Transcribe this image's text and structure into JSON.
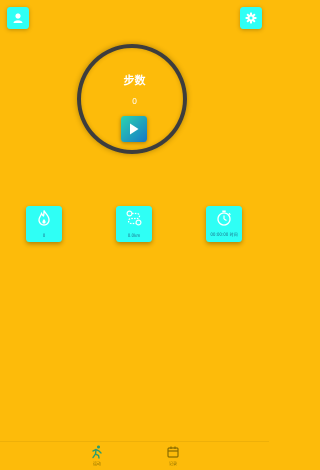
{
  "header": {
    "profile_icon": "person-icon",
    "settings_icon": "gear-icon"
  },
  "steps": {
    "title": "步数",
    "count": "0",
    "play_icon": "play-icon"
  },
  "stats": [
    {
      "icon": "flame-icon",
      "value": "0"
    },
    {
      "icon": "route-icon",
      "value": "0.0km"
    },
    {
      "icon": "stopwatch-icon",
      "value": "00:00:00 时间"
    }
  ],
  "tabbar": {
    "tabs": [
      {
        "icon": "run-icon",
        "label": "运动"
      },
      {
        "icon": "history-icon",
        "label": "记录"
      }
    ]
  },
  "colors": {
    "background": "#FDBB0A",
    "accent": "#2FFFF5",
    "ring": "#3d3d3d",
    "play_start": "#2cd4b0",
    "play_end": "#1677c8"
  }
}
